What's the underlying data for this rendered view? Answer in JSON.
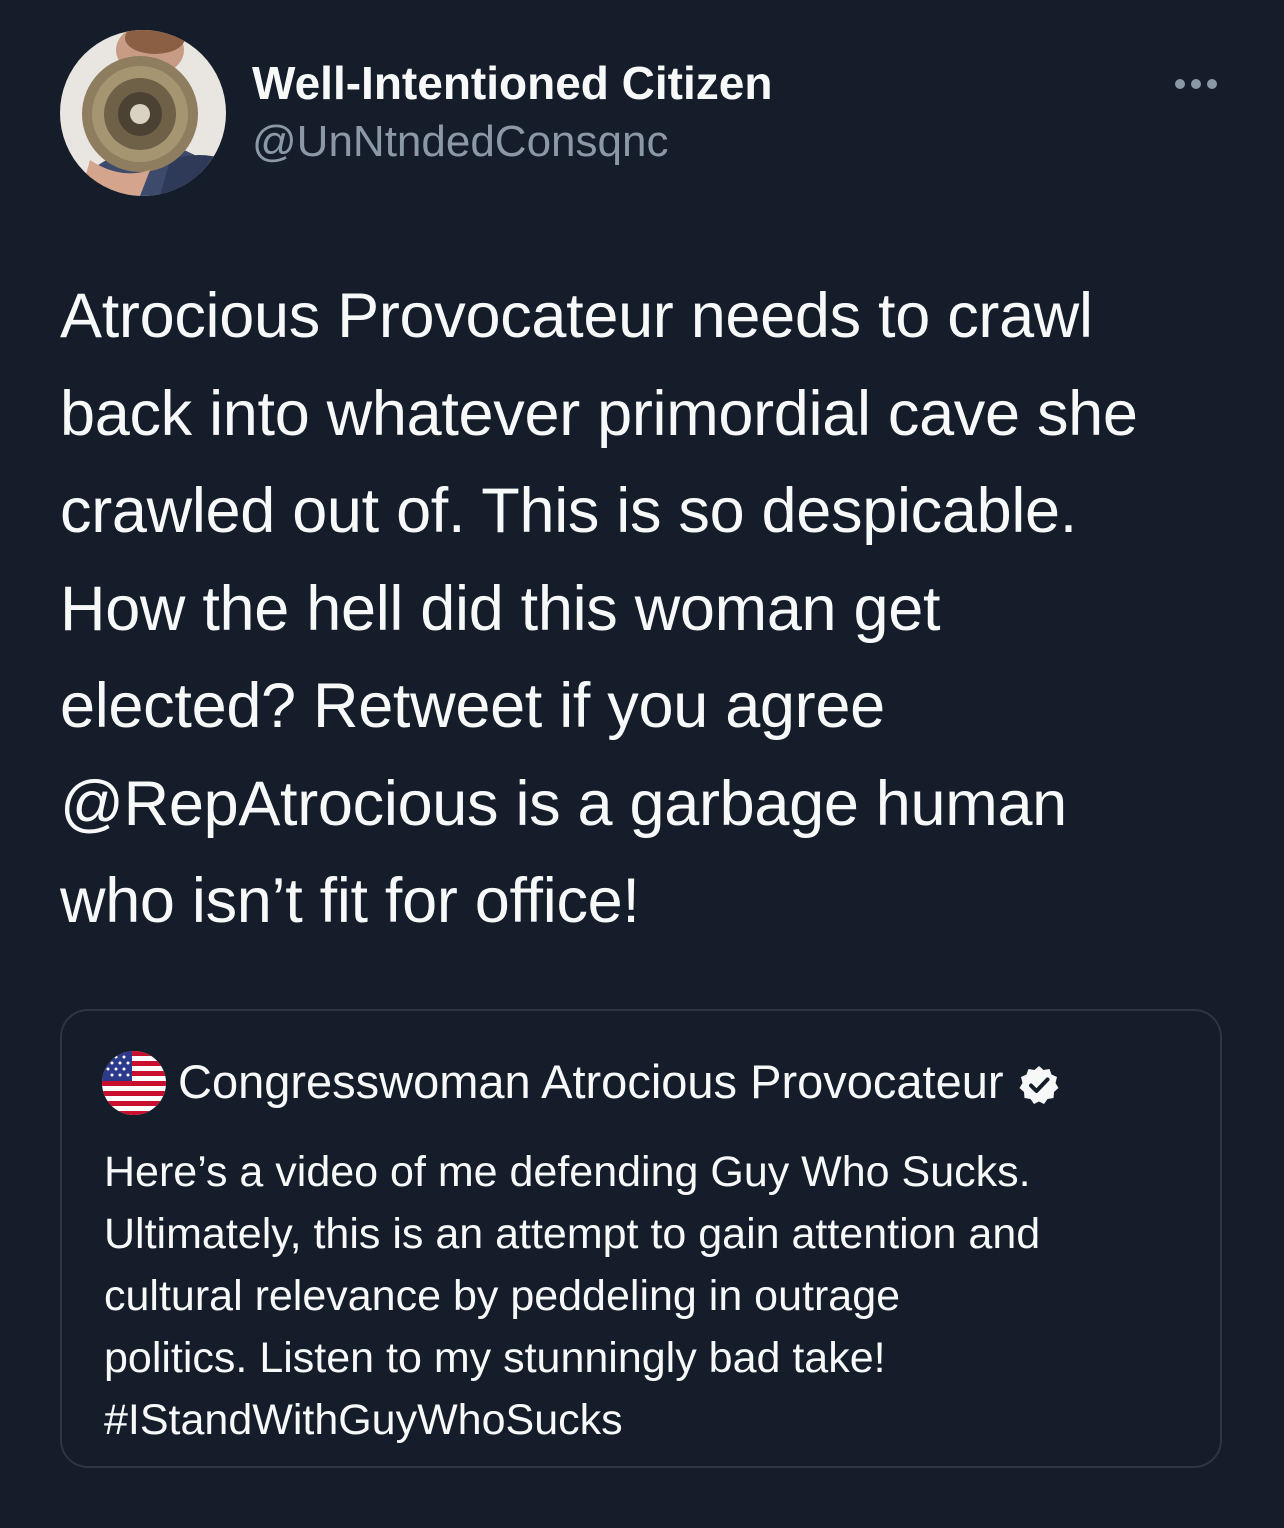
{
  "author": {
    "display_name": "Well-Intentioned Citizen",
    "handle": "@UnNtndedConsqnc",
    "avatar_icon": "person-with-megaphone-avatar"
  },
  "more_icon": "more-options-icon",
  "tweet_text_lines": [
    "Atrocious Provocateur needs to crawl",
    "back into whatever primordial cave she",
    "crawled out of. This is so despicable.",
    "How the hell did this woman get",
    "elected? Retweet if you agree",
    "@RepAtrocious is a garbage human",
    "who isn’t fit for office!"
  ],
  "quoted_tweet": {
    "avatar_icon": "us-flag-avatar",
    "display_name": "Congresswoman Atrocious Provocateur",
    "verified_icon": "verified-badge-icon",
    "text_lines": [
      "Here’s a video of me defending Guy Who Sucks.",
      "Ultimately, this is an attempt to gain attention and",
      "cultural relevance by peddeling in outrage",
      "politics. Listen to my stunningly bad take!",
      "#IStandWithGuyWhoSucks"
    ]
  },
  "colors": {
    "background": "#161d2a",
    "primary_text": "#f7f9f9",
    "secondary_text": "#8b98a5",
    "quote_border": "#2f3640"
  }
}
